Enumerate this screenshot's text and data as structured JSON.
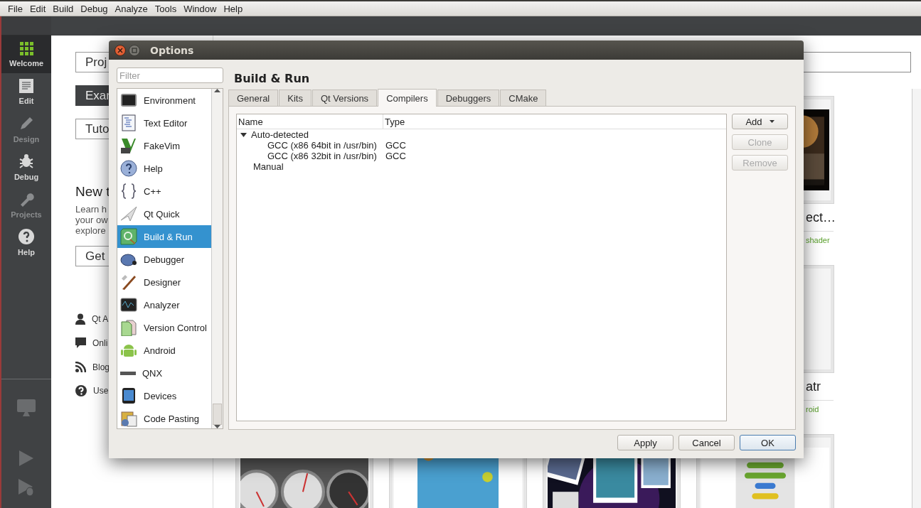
{
  "menu": [
    {
      "label": "File"
    },
    {
      "label": "Edit"
    },
    {
      "label": "Build"
    },
    {
      "label": "Debug"
    },
    {
      "label": "Analyze"
    },
    {
      "label": "Tools"
    },
    {
      "label": "Window"
    },
    {
      "label": "Help"
    }
  ],
  "modes": [
    {
      "label": "Welcome",
      "selected": true,
      "disabled": false
    },
    {
      "label": "Edit",
      "selected": false,
      "disabled": false
    },
    {
      "label": "Design",
      "selected": false,
      "disabled": true
    },
    {
      "label": "Debug",
      "selected": false,
      "disabled": false
    },
    {
      "label": "Projects",
      "selected": false,
      "disabled": true
    },
    {
      "label": "Help",
      "selected": false,
      "disabled": false
    }
  ],
  "welcome": {
    "buttons": [
      {
        "label": "Proj",
        "selected": false
      },
      {
        "label": "Exar",
        "selected": true
      },
      {
        "label": "Tuto",
        "selected": false
      }
    ],
    "heading": "New t",
    "lines": [
      "Learn h",
      "your ow",
      "explore"
    ],
    "get_started": "Get",
    "links": [
      "Qt A",
      "Onli",
      "Blog",
      "Use"
    ]
  },
  "gallery": {
    "rows": [
      {
        "cards": [
          {
            "kind": "picture",
            "title": "ect…",
            "tags": "shader"
          }
        ]
      },
      {
        "cards": [
          {
            "kind": "blank",
            "title": "atr",
            "tags": "roid"
          }
        ]
      },
      {
        "cards": [
          {
            "kind": "picture"
          },
          {
            "kind": "picture"
          },
          {
            "kind": "picture"
          },
          {
            "kind": "picture"
          }
        ]
      }
    ]
  },
  "dialog": {
    "title": "Options",
    "filter": {
      "placeholder": "Filter"
    },
    "categories": [
      {
        "label": "Environment",
        "selected": false
      },
      {
        "label": "Text Editor",
        "selected": false
      },
      {
        "label": "FakeVim",
        "selected": false
      },
      {
        "label": "Help",
        "selected": false
      },
      {
        "label": "C++",
        "selected": false
      },
      {
        "label": "Qt Quick",
        "selected": false
      },
      {
        "label": "Build & Run",
        "selected": true
      },
      {
        "label": "Debugger",
        "selected": false
      },
      {
        "label": "Designer",
        "selected": false
      },
      {
        "label": "Analyzer",
        "selected": false
      },
      {
        "label": "Version Control",
        "selected": false
      },
      {
        "label": "Android",
        "selected": false
      },
      {
        "label": "QNX",
        "selected": false
      },
      {
        "label": "Devices",
        "selected": false
      },
      {
        "label": "Code Pasting",
        "selected": false
      }
    ],
    "heading": "Build & Run",
    "tabs": [
      {
        "label": "General",
        "selected": false
      },
      {
        "label": "Kits",
        "selected": false
      },
      {
        "label": "Qt Versions",
        "selected": false
      },
      {
        "label": "Compilers",
        "selected": true
      },
      {
        "label": "Debuggers",
        "selected": false
      },
      {
        "label": "CMake",
        "selected": false
      }
    ],
    "tree": {
      "columns": [
        "Name",
        "Type"
      ],
      "rows": [
        {
          "name": "Auto-detected",
          "expanded": true,
          "children": [
            {
              "name": "GCC (x86 64bit in /usr/bin)",
              "type": "GCC"
            },
            {
              "name": "GCC (x86 32bit in /usr/bin)",
              "type": "GCC"
            }
          ]
        },
        {
          "name": "Manual"
        }
      ]
    },
    "side_buttons": [
      {
        "label": "Add",
        "kind": "menu",
        "disabled": false
      },
      {
        "label": "Clone",
        "kind": "plain",
        "disabled": true
      },
      {
        "label": "Remove",
        "kind": "plain",
        "disabled": true
      }
    ],
    "buttons": [
      {
        "label": "Apply",
        "default": false
      },
      {
        "label": "Cancel",
        "default": false
      },
      {
        "label": "OK",
        "default": true
      }
    ]
  }
}
